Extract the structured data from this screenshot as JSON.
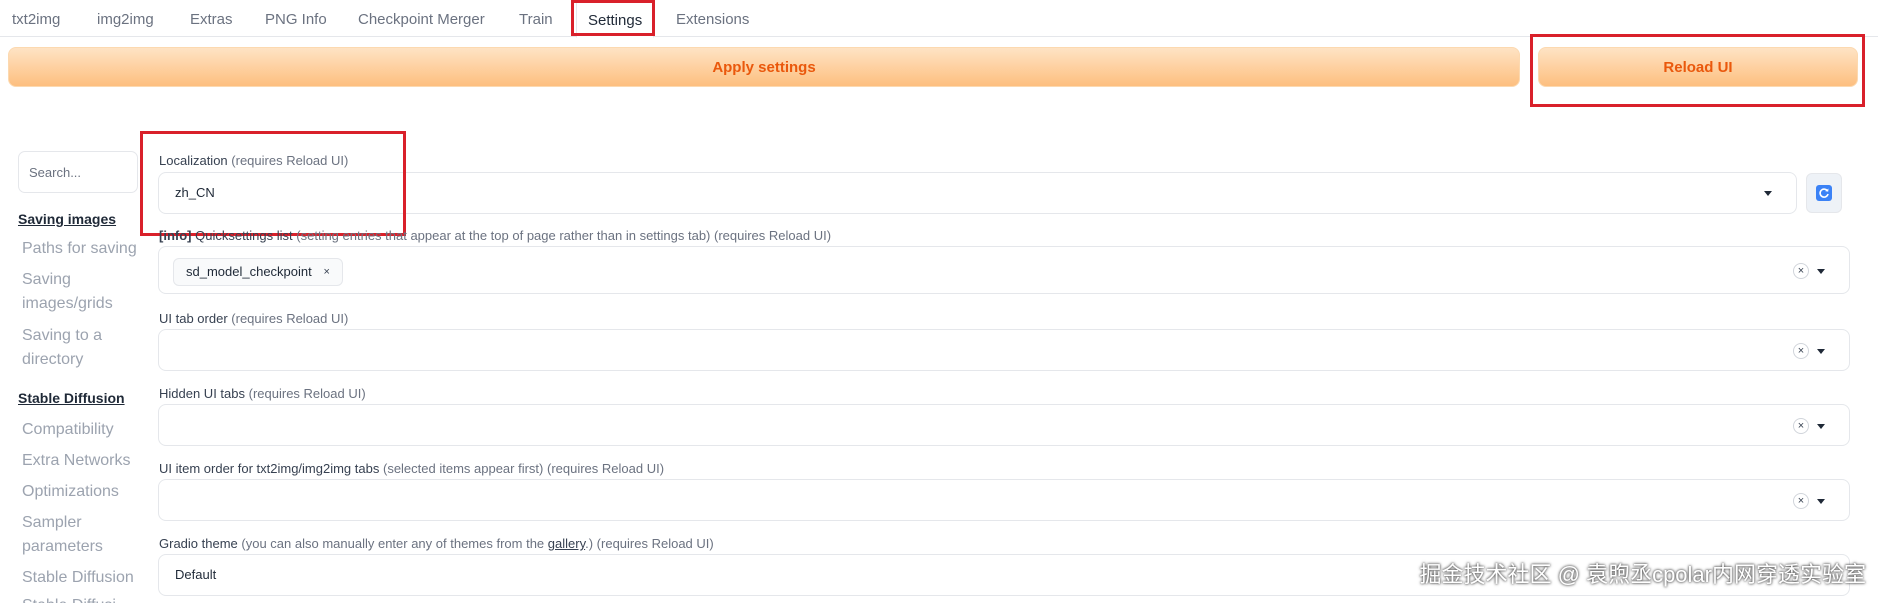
{
  "tabs": [
    "txt2img",
    "img2img",
    "Extras",
    "PNG Info",
    "Checkpoint Merger",
    "Train",
    "Settings",
    "Extensions"
  ],
  "actions": {
    "apply_label": "Apply settings",
    "reload_label": "Reload UI"
  },
  "colors": {
    "accent": "#ea580c",
    "highlight_box": "#d9202a"
  },
  "sidebar": {
    "search_placeholder": "Search...",
    "sections": [
      {
        "heading": "Saving images",
        "items": [
          "Paths for saving",
          "Saving images/grids",
          "Saving to a directory"
        ]
      },
      {
        "heading": "Stable Diffusion",
        "items": [
          "Compatibility",
          "Extra Networks",
          "Optimizations",
          "Sampler parameters",
          "Stable Diffusion",
          "Stable Diffusi"
        ]
      }
    ]
  },
  "settings": {
    "localization": {
      "label": "Localization",
      "hint": "(requires Reload UI)",
      "value": "zh_CN",
      "refresh_icon": "refresh-icon"
    },
    "quicksettings": {
      "info_tag": "[info]",
      "label": "Quicksettings list",
      "hint": "(setting entries that appear at the top of page rather than in settings tab) (requires Reload UI)",
      "chips": [
        "sd_model_checkpoint"
      ]
    },
    "ui_tab_order": {
      "label": "UI tab order",
      "hint": "(requires Reload UI)"
    },
    "hidden_ui_tabs": {
      "label": "Hidden UI tabs",
      "hint": "(requires Reload UI)"
    },
    "ui_item_order": {
      "label": "UI item order for txt2img/img2img tabs",
      "hint": "(selected items appear first) (requires Reload UI)"
    },
    "gradio_theme": {
      "label": "Gradio theme",
      "hint_prefix": "(you can also manually enter any of themes from the",
      "hint_link": "gallery",
      "hint_suffix": ".) (requires Reload UI)",
      "value": "Default"
    }
  },
  "watermark": "掘金技术社区 @ 袁煦丞cpolar内网穿透实验室"
}
